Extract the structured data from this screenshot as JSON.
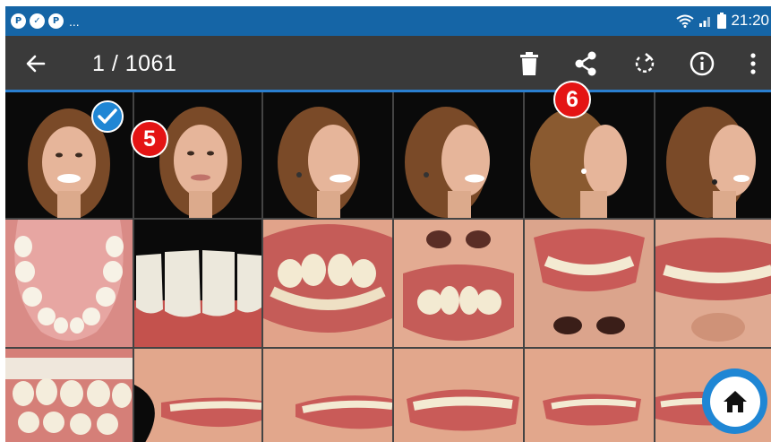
{
  "status_bar": {
    "notifications": [
      "P",
      "✓",
      "P"
    ],
    "more": "...",
    "time": "21:20"
  },
  "toolbar": {
    "counter": "1 / 1061",
    "actions": [
      "delete-icon",
      "share-icon",
      "rotate-icon",
      "info-icon",
      "more-vert-icon"
    ]
  },
  "callouts": {
    "five": "5",
    "six": "6"
  },
  "gallery": {
    "rows": [
      [
        "portrait-frontal-smile",
        "portrait-frontal-relaxed",
        "portrait-45-smile",
        "portrait-45-smile-2",
        "portrait-profile",
        "portrait-45-right"
      ],
      [
        "occlusal-upper",
        "anterior-closeup",
        "smile-closeup",
        "smile-view-from-below",
        "smile-upside-down",
        "smile-upside-down-2"
      ],
      [
        "buccal-right",
        "lips-lateral",
        "lips-lateral-2",
        "smile-lateral",
        "smile-lateral-2",
        "smile-lateral-3"
      ]
    ],
    "selected_index": 0
  },
  "colors": {
    "status_bar": "#1565a6",
    "toolbar": "#3a3a3a",
    "accent": "#1f86d4",
    "callout": "#e41414"
  }
}
